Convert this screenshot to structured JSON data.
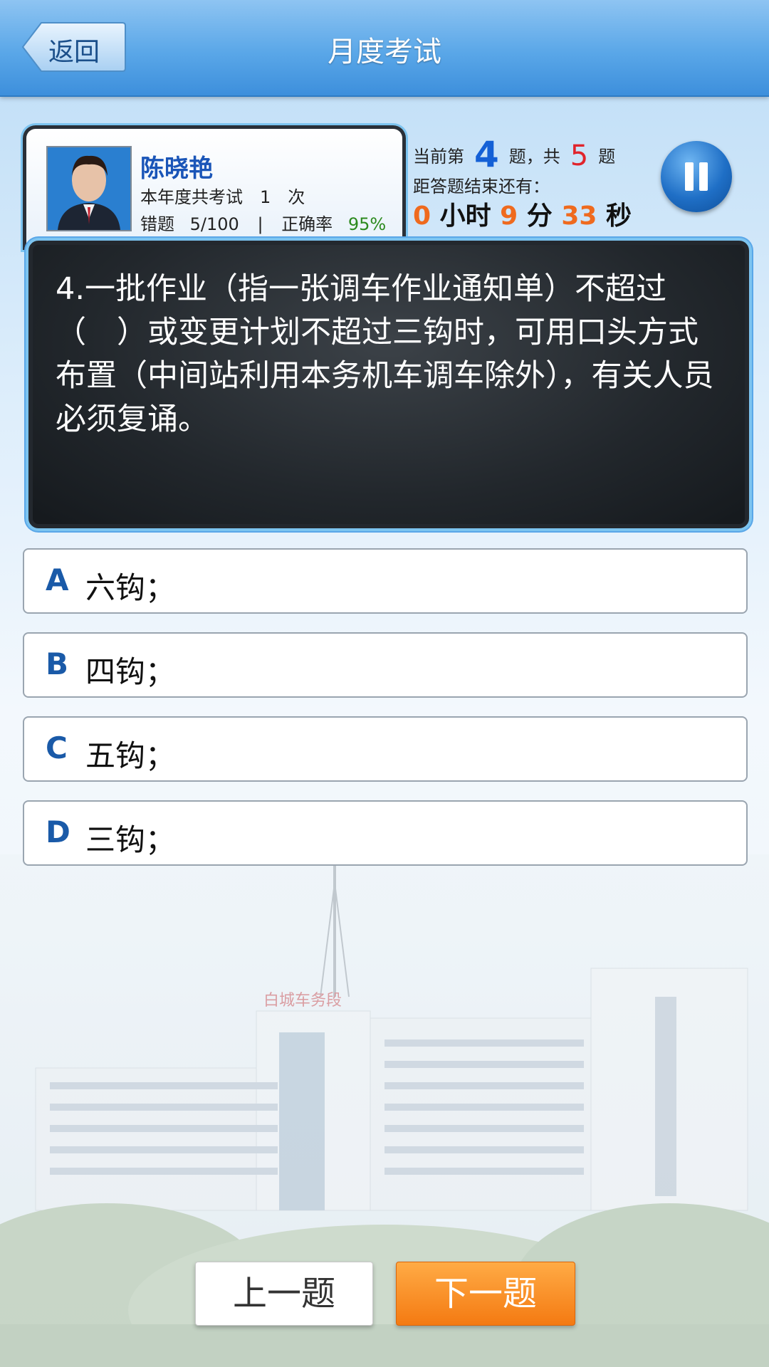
{
  "header": {
    "back_label": "返回",
    "title": "月度考试"
  },
  "profile": {
    "name": "陈晓艳",
    "exam_count_text": "本年度共考试　1　次",
    "wrong_label": "错题",
    "wrong_value": "5/100",
    "separator": "|",
    "accuracy_label": "正确率",
    "accuracy_value": "95%"
  },
  "progress": {
    "current_prefix": "当前第",
    "current": "4",
    "total_prefix": "题，共",
    "total": "5",
    "total_suffix": "题",
    "remaining_label": "距答题结束还有：",
    "hours": "0",
    "hours_unit": "小时",
    "minutes": "9",
    "minutes_unit": "分",
    "seconds": "33",
    "seconds_unit": "秒"
  },
  "question": {
    "text": "4.一批作业（指一张调车作业通知单）不超过（　）或变更计划不超过三钩时，可用口头方式布置（中间站利用本务机车调车除外），有关人员必须复诵。"
  },
  "options": [
    {
      "letter": "A",
      "text": "六钩；"
    },
    {
      "letter": "B",
      "text": "四钩；"
    },
    {
      "letter": "C",
      "text": "五钩；"
    },
    {
      "letter": "D",
      "text": "三钩；"
    }
  ],
  "footer": {
    "prev_label": "上一题",
    "next_label": "下一题"
  },
  "background": {
    "building_sign": "白城车务段"
  },
  "icons": {
    "back": "back-arrow-icon",
    "pause": "pause-icon"
  },
  "colors": {
    "header_blue": "#5aa7e8",
    "accent_orange": "#f47a12",
    "timer_orange": "#ef6a1e",
    "total_red": "#e0242c",
    "current_blue": "#1460d6",
    "accuracy_green": "#2c8a1e"
  }
}
